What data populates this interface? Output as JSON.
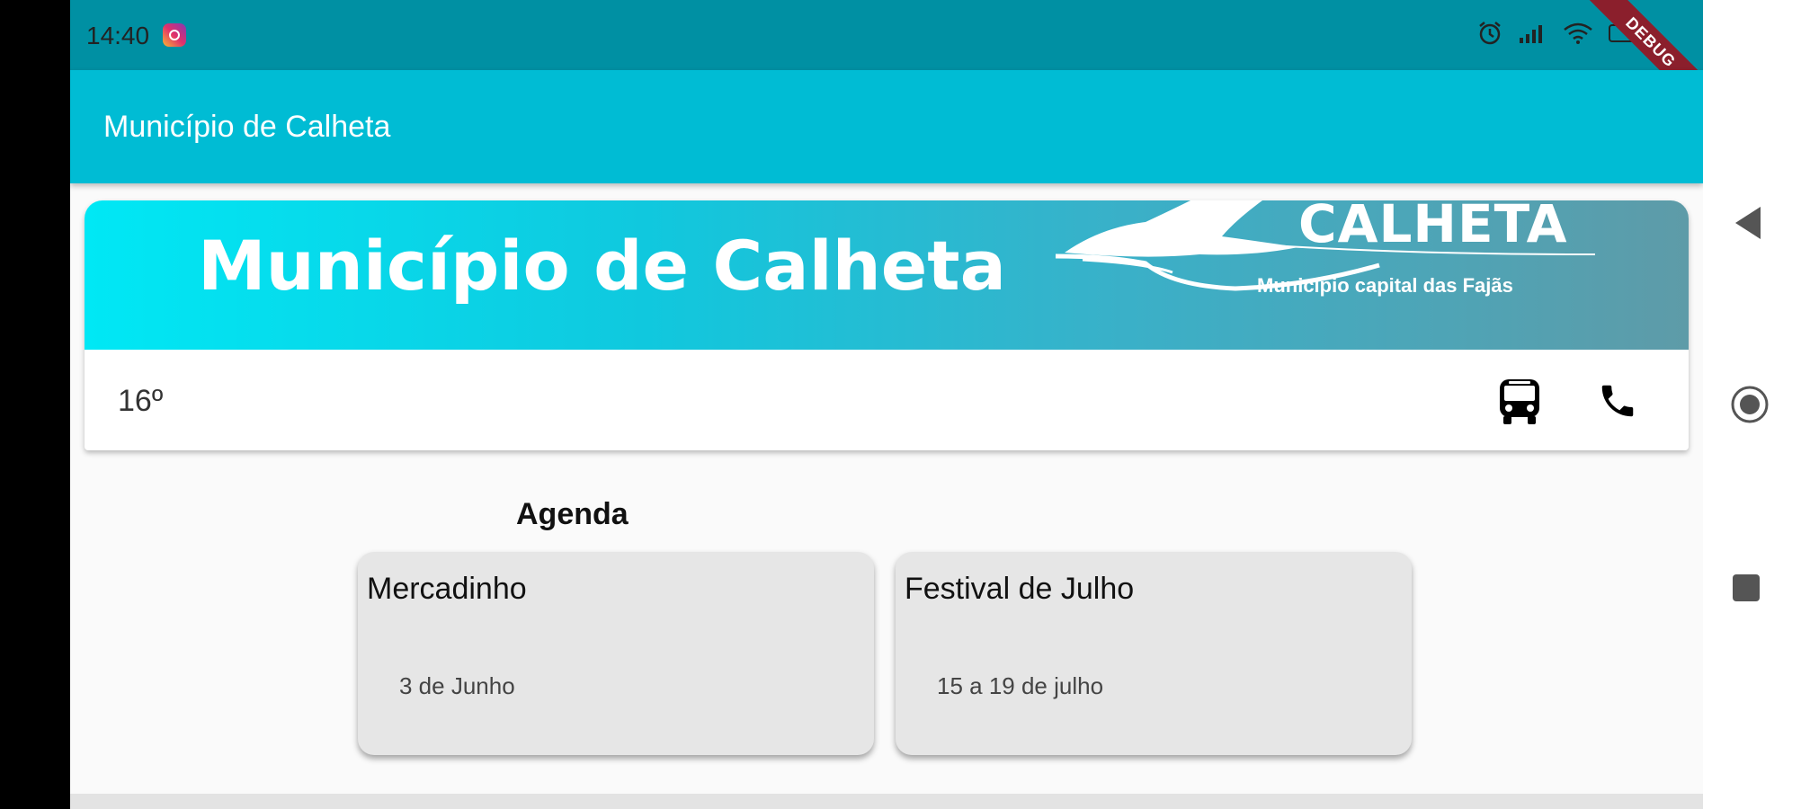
{
  "status_bar": {
    "time": "14:40",
    "debug_label": "DEBUG",
    "icons": [
      "instagram-icon",
      "alarm-icon",
      "signal-icon",
      "wifi-icon",
      "battery-icon"
    ]
  },
  "app_bar": {
    "title": "Município de Calheta"
  },
  "banner": {
    "title": "Município de Calheta",
    "brand": "CALHETA",
    "tagline": "Município capital das Fajãs"
  },
  "info_row": {
    "temperature": "16º",
    "icons": [
      "bus-icon",
      "phone-icon"
    ]
  },
  "agenda": {
    "title": "Agenda",
    "events": [
      {
        "name": "Mercadinho",
        "date": "3 de Junho"
      },
      {
        "name": "Festival de Julho",
        "date": "15 a 19 de julho"
      }
    ]
  },
  "nav": {
    "icons": [
      "back-icon",
      "home-icon",
      "recents-icon"
    ]
  },
  "colors": {
    "status_bar": "#0090a3",
    "app_bar": "#00bcd4",
    "event_card": "#e6e6e6",
    "debug_ribbon": "#8b1f2c"
  }
}
